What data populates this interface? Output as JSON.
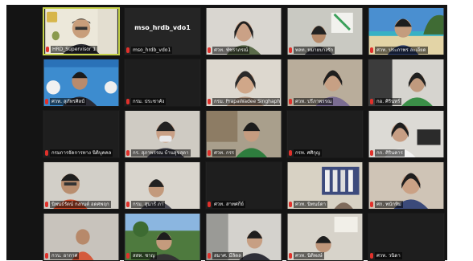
{
  "colors": {
    "active_border": "#c7d34a",
    "muted_mic": "#e0312b",
    "grid_background": "#141414"
  },
  "center_tile_title": "mso_hrdb_vdo1",
  "participants": [
    {
      "name": "HRD_Supervisor 1",
      "muted": true
    },
    {
      "name": "mso_hrdb_vdo1",
      "muted": true
    },
    {
      "name": "ศวท. พัชราภรณ์",
      "muted": true
    },
    {
      "name": "พลท. หมายบางรัก",
      "muted": true
    },
    {
      "name": "ศวท. ประภาพร ละเอียด",
      "muted": true
    },
    {
      "name": "ศวท. สุภัทรศิลป์",
      "muted": true
    },
    {
      "name": "กรม. ประชาคัง",
      "muted": true
    },
    {
      "name": "กรม. PrapaWadee Singhaphet",
      "muted": true
    },
    {
      "name": "ศวท. ปรีภาพรรณ",
      "muted": true
    },
    {
      "name": "กอ. ศิรินทร์",
      "muted": true
    },
    {
      "name": "กรมการจัดการทาง นิติบุคคล",
      "muted": true
    },
    {
      "name": "กร. สุภาพรรณ บ้านสุขสุดา",
      "muted": true
    },
    {
      "name": "ศวท. กรร",
      "muted": true
    },
    {
      "name": "กรท. ศศิกุญ",
      "muted": true
    },
    {
      "name": "กก. ศิรินคาร",
      "muted": true
    },
    {
      "name": "นิพนธ์รัตน์ กงกนต์ อดศพฤก",
      "muted": true
    },
    {
      "name": "กรม. สุนารี ภา",
      "muted": true
    },
    {
      "name": "ศวท. สาทศกีย์",
      "muted": true
    },
    {
      "name": "ศวท. นิพนธ์ดา",
      "muted": true
    },
    {
      "name": "ศก. พนักทิม",
      "muted": true
    },
    {
      "name": "กวบ. อากาศ",
      "muted": true
    },
    {
      "name": "สสท. ชาญ",
      "muted": true
    },
    {
      "name": "สมาศ. มีลิดล",
      "muted": true
    },
    {
      "name": "ศวท. นิติพงษ์",
      "muted": true
    },
    {
      "name": "ศวท. วนิดา",
      "muted": true
    },
    {
      "name": "กวศ. สมพร",
      "muted": true
    }
  ]
}
